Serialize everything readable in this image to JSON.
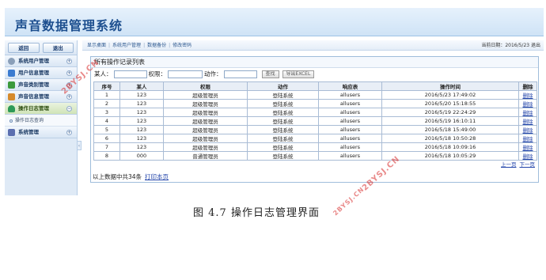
{
  "app": {
    "title": "声音数据管理系统"
  },
  "sidebar": {
    "back_label": "返回",
    "logout_label": "退出",
    "items": [
      {
        "label": "系统用户管理",
        "icon": "gear-icon",
        "color": "#8a9fb9"
      },
      {
        "label": "用户信息管理",
        "icon": "list-icon",
        "color": "#3b7bd0"
      },
      {
        "label": "声音类别管理",
        "icon": "book-icon",
        "color": "#3c9a3c"
      },
      {
        "label": "声音信息管理",
        "icon": "grid-icon",
        "color": "#d68a2b"
      },
      {
        "label": "操作日志管理",
        "icon": "user-icon",
        "color": "#2e9a57"
      },
      {
        "label": "系统管理",
        "icon": "chart-icon",
        "color": "#5b6fb0"
      }
    ],
    "submenu": {
      "label": "操作日志查询"
    },
    "collapse_glyph": "‹"
  },
  "navbar": {
    "links": [
      "显示桌面",
      "系统用户管理",
      "数据备份",
      "修改密码"
    ],
    "separator": "|",
    "date": "当前日期：2016/5/23 退出"
  },
  "panel": {
    "title": "所有操作记录列表",
    "filters": {
      "user_label": "某人：",
      "perm_label": "权限：",
      "action_label": "动作："
    },
    "search_label": "查找",
    "export_label": "导出EXCEL",
    "columns": [
      "序号",
      "某人",
      "权限",
      "动作",
      "响应表",
      "操作时间",
      "删除"
    ],
    "rows": [
      [
        "1",
        "123",
        "超级管理员",
        "登陆系统",
        "allusers",
        "2016/5/23 17:49:02",
        "删除"
      ],
      [
        "2",
        "123",
        "超级管理员",
        "登陆系统",
        "allusers",
        "2016/5/20 15:18:55",
        "删除"
      ],
      [
        "3",
        "123",
        "超级管理员",
        "登陆系统",
        "allusers",
        "2016/5/19 22:24:29",
        "删除"
      ],
      [
        "4",
        "123",
        "超级管理员",
        "登陆系统",
        "allusers",
        "2016/5/19 16:10:11",
        "删除"
      ],
      [
        "5",
        "123",
        "超级管理员",
        "登陆系统",
        "allusers",
        "2016/5/18 15:49:00",
        "删除"
      ],
      [
        "6",
        "123",
        "超级管理员",
        "登陆系统",
        "allusers",
        "2016/5/18 10:50:28",
        "删除"
      ],
      [
        "7",
        "123",
        "超级管理员",
        "登陆系统",
        "allusers",
        "2016/5/18 10:09:16",
        "删除"
      ],
      [
        "8",
        "000",
        "普通管理员",
        "登陆系统",
        "allusers",
        "2016/5/18 10:05:29",
        "删除"
      ]
    ],
    "pager": {
      "prev": "上一页",
      "next": "下一页"
    },
    "summary": "以上数据中共34条",
    "print_label": "打印本页"
  },
  "caption": "图 4.7 操作日志管理界面",
  "watermarks": [
    "2BYSJ.CN",
    "2BYSJ.CN",
    "2BYSJ.CN"
  ]
}
